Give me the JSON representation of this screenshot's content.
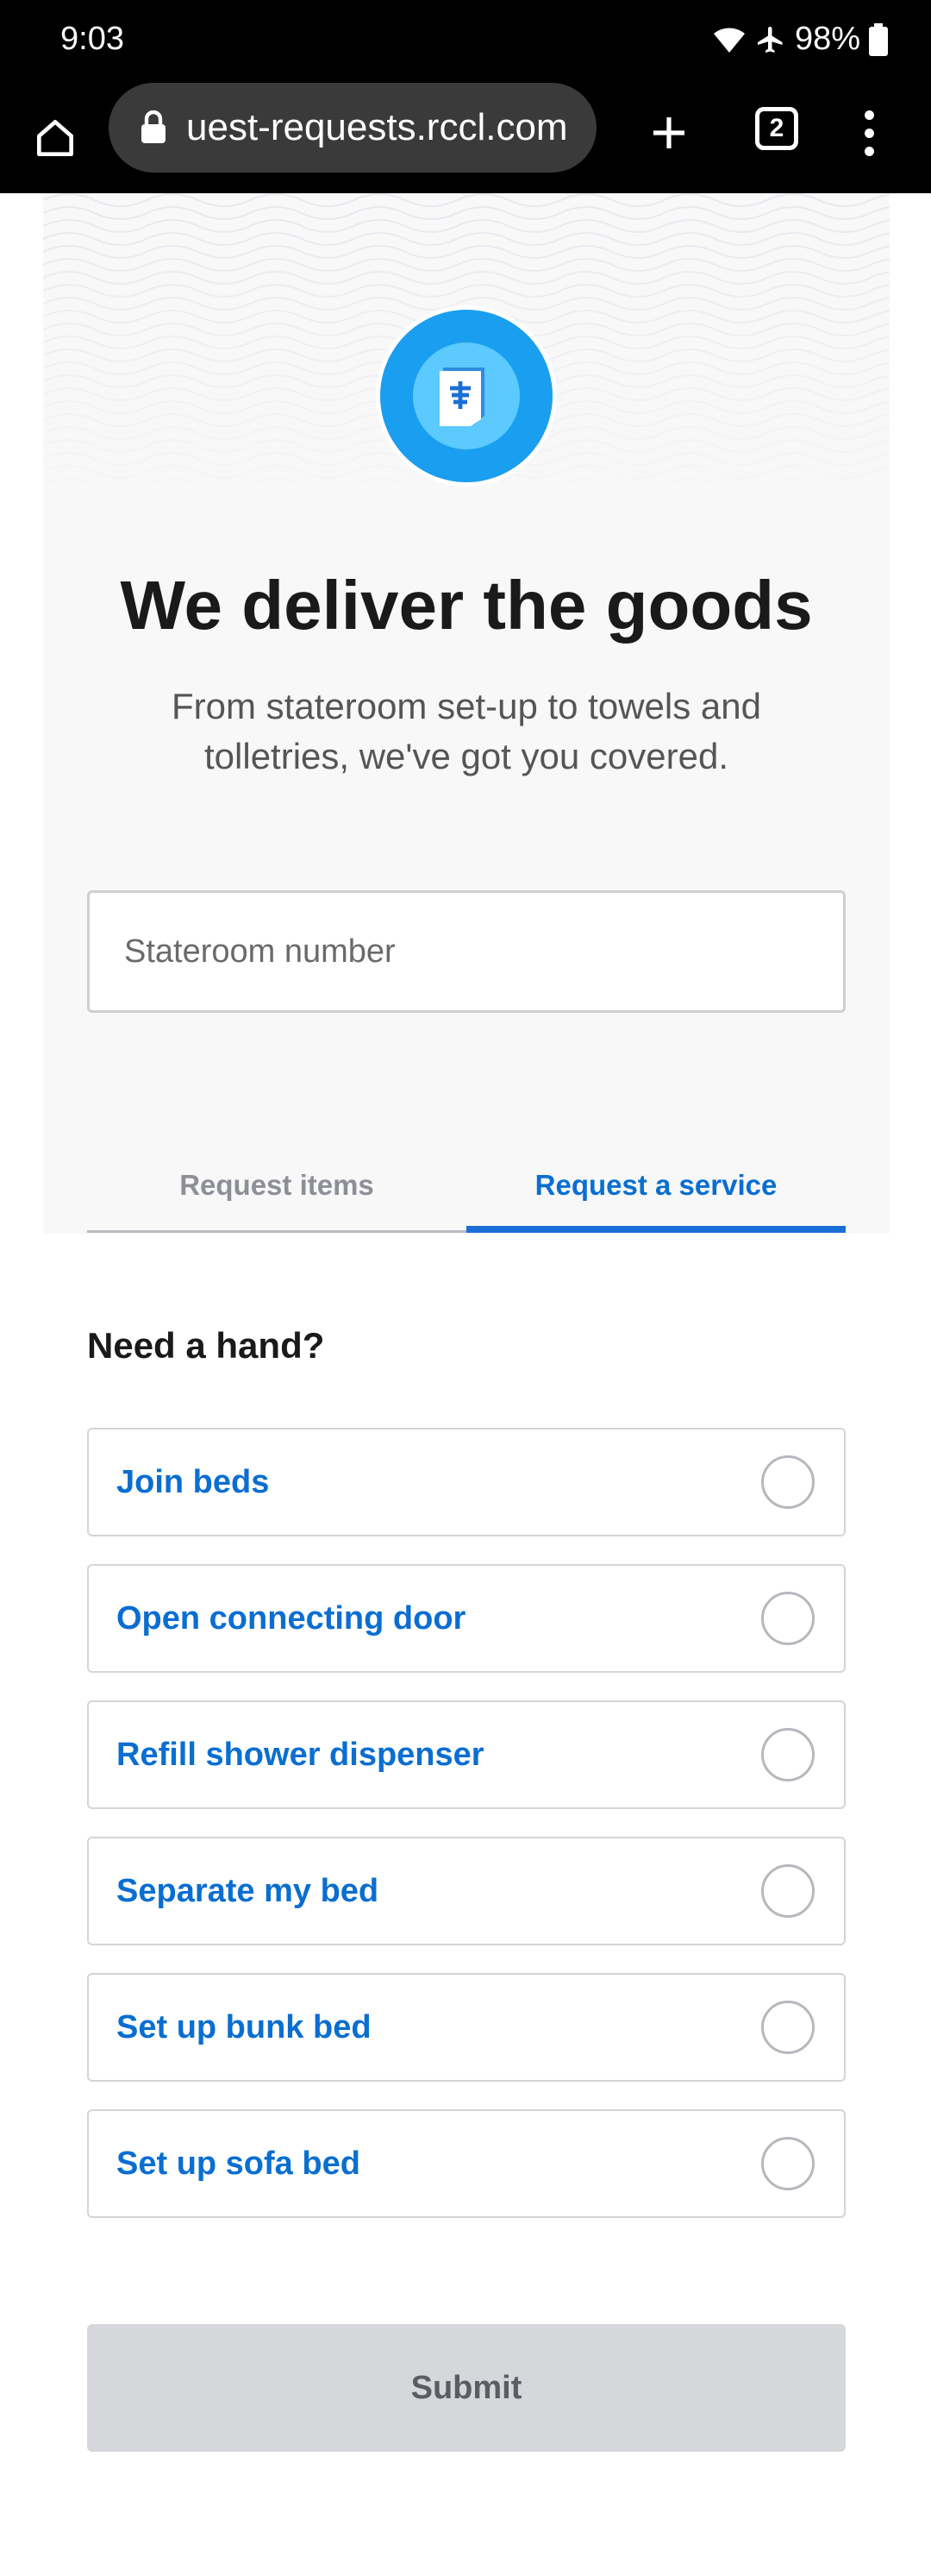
{
  "status_bar": {
    "time": "9:03",
    "battery": "98%",
    "icons": [
      "wifi-icon",
      "airplane-icon",
      "battery-icon"
    ]
  },
  "browser": {
    "url": "uest-requests.rccl.com",
    "tab_count": "2",
    "icons": [
      "home-icon",
      "lock-icon",
      "plus-icon",
      "tabs-icon",
      "more-vert-icon"
    ]
  },
  "hero": {
    "icon": "ship-logo-icon",
    "title": "We deliver the goods",
    "subtitle": "From stateroom set-up to towels and tolletries, we've got you covered.",
    "stateroom_placeholder": "Stateroom number",
    "stateroom_value": ""
  },
  "tabs": [
    {
      "label": "Request items",
      "active": false
    },
    {
      "label": "Request a service",
      "active": true
    }
  ],
  "services": {
    "heading": "Need a hand?",
    "items": [
      {
        "label": "Join beds",
        "selected": false
      },
      {
        "label": "Open connecting door",
        "selected": false
      },
      {
        "label": "Refill shower dispenser",
        "selected": false
      },
      {
        "label": "Separate my bed",
        "selected": false
      },
      {
        "label": "Set up bunk bed",
        "selected": false
      },
      {
        "label": "Set up sofa bed",
        "selected": false
      }
    ]
  },
  "submit": {
    "label": "Submit",
    "enabled": false
  },
  "colors": {
    "accent": "#0a6ed1",
    "icon_blue": "#1a9ef0",
    "icon_light": "#5cc9ff",
    "disabled_button": "#d6d7db"
  }
}
